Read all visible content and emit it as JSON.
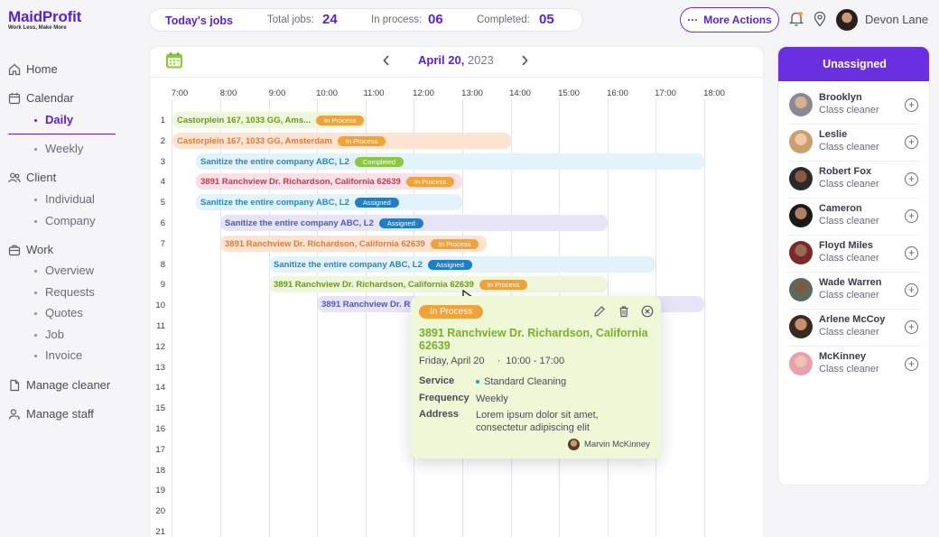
{
  "brand": {
    "name": "MaidProfit",
    "tagline": "Work Less, Make More"
  },
  "sidebar": {
    "home": "Home",
    "calendar": "Calendar",
    "daily": "Daily",
    "weekly": "Weekly",
    "client": "Client",
    "individual": "Individual",
    "company": "Company",
    "work": "Work",
    "overview": "Overview",
    "requests": "Requests",
    "quotes": "Quotes",
    "job": "Job",
    "invoice": "Invoice",
    "manage_cleaner": "Manage cleaner",
    "manage_staff": "Manage staff"
  },
  "topbar": {
    "title": "Today's jobs",
    "total_label": "Total jobs:",
    "total": "24",
    "inprocess_label": "In process:",
    "inprocess": "06",
    "completed_label": "Completed:",
    "completed": "05"
  },
  "header": {
    "more_actions": "More Actions",
    "more_icon": "···",
    "user": "Devon Lane"
  },
  "calendar": {
    "month_day": "April 20,",
    "year": "2023",
    "times": [
      "7:00",
      "8:00",
      "9:00",
      "10:00",
      "11:00",
      "12:00",
      "13:00",
      "14:00",
      "15:00",
      "16:00",
      "17:00",
      "18:00"
    ],
    "rows": [
      "1",
      "2",
      "3",
      "4",
      "5",
      "6",
      "7",
      "8",
      "9",
      "10",
      "11",
      "12",
      "13",
      "14",
      "15",
      "16",
      "17",
      "18",
      "19",
      "20",
      "21"
    ]
  },
  "jobs": [
    {
      "text": "Castorplein 167, 1033 GG, Ams...",
      "status": "In Process"
    },
    {
      "text": "Castorplein 167, 1033 GG, Amsterdam",
      "status": "In Process"
    },
    {
      "text": "Sanitize the entire company ABC, L2",
      "status": "Completed"
    },
    {
      "text": "3891 Ranchview Dr. Richardson, California 62639",
      "status": "In Process"
    },
    {
      "text": "Sanitize the entire company ABC, L2",
      "status": "Assigned"
    },
    {
      "text": "Sanitize the entire company ABC, L2",
      "status": "Assigned"
    },
    {
      "text": "3891 Ranchview Dr. Richardson, California 62639",
      "status": "In Process"
    },
    {
      "text": "Sanitize the entire company ABC, L2",
      "status": "Assigned"
    },
    {
      "text": "3891 Ranchview Dr. Richardson, California 62639",
      "status": "In Process"
    },
    {
      "text": "3891 Ranchview Dr. Ri",
      "status": ""
    }
  ],
  "popup": {
    "status": "In Process",
    "title": "3891 Ranchview Dr. Richardson, California 62639",
    "date": "Friday, April 20",
    "time": "10:00 - 17:00",
    "service_label": "Service",
    "service": "Standard Cleaning",
    "frequency_label": "Frequency",
    "frequency": "Weekly",
    "address_label": "Address",
    "address": "Lorem ipsum dolor sit amet, consectetur adipiscing elit",
    "assignee": "Marvin McKinney"
  },
  "unassigned": {
    "title": "Unassigned",
    "cleaners": [
      {
        "name": "Brooklyn",
        "role": "Class cleaner"
      },
      {
        "name": "Leslie",
        "role": "Class cleaner"
      },
      {
        "name": "Robert Fox",
        "role": "Class cleaner"
      },
      {
        "name": "Cameron",
        "role": "Class cleaner"
      },
      {
        "name": "Floyd Miles",
        "role": "Class cleaner"
      },
      {
        "name": "Wade Warren",
        "role": "Class cleaner"
      },
      {
        "name": "Arlene McCoy",
        "role": "Class cleaner"
      },
      {
        "name": "McKinney",
        "role": "Class cleaner"
      }
    ]
  },
  "colors": {
    "accent": "#5b1fd6",
    "in_process": "#f0a23b",
    "completed": "#8dc63f",
    "assigned": "#1f7fc4"
  }
}
